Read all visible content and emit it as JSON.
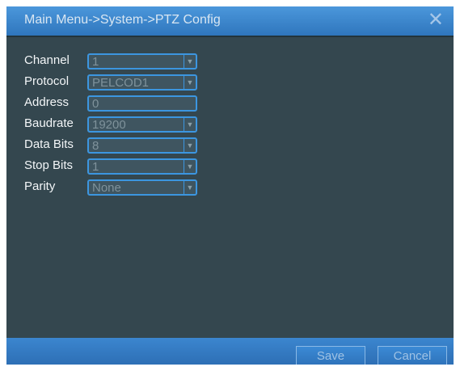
{
  "window": {
    "title": "Main Menu->System->PTZ Config",
    "close_icon": "close-icon"
  },
  "fields": [
    {
      "label": "Channel",
      "value": "1",
      "type": "select"
    },
    {
      "label": "Protocol",
      "value": "PELCOD1",
      "type": "select"
    },
    {
      "label": "Address",
      "value": "0",
      "type": "input"
    },
    {
      "label": "Baudrate",
      "value": "19200",
      "type": "select"
    },
    {
      "label": "Data Bits",
      "value": "8",
      "type": "select"
    },
    {
      "label": "Stop Bits",
      "value": "1",
      "type": "select"
    },
    {
      "label": "Parity",
      "value": "None",
      "type": "select"
    }
  ],
  "buttons": {
    "save": "Save",
    "cancel": "Cancel"
  },
  "colors": {
    "panel_bg": "#34474f",
    "title_bar": "#3f8bd6",
    "field_border": "#3c96e0",
    "field_text": "#7f929b"
  }
}
